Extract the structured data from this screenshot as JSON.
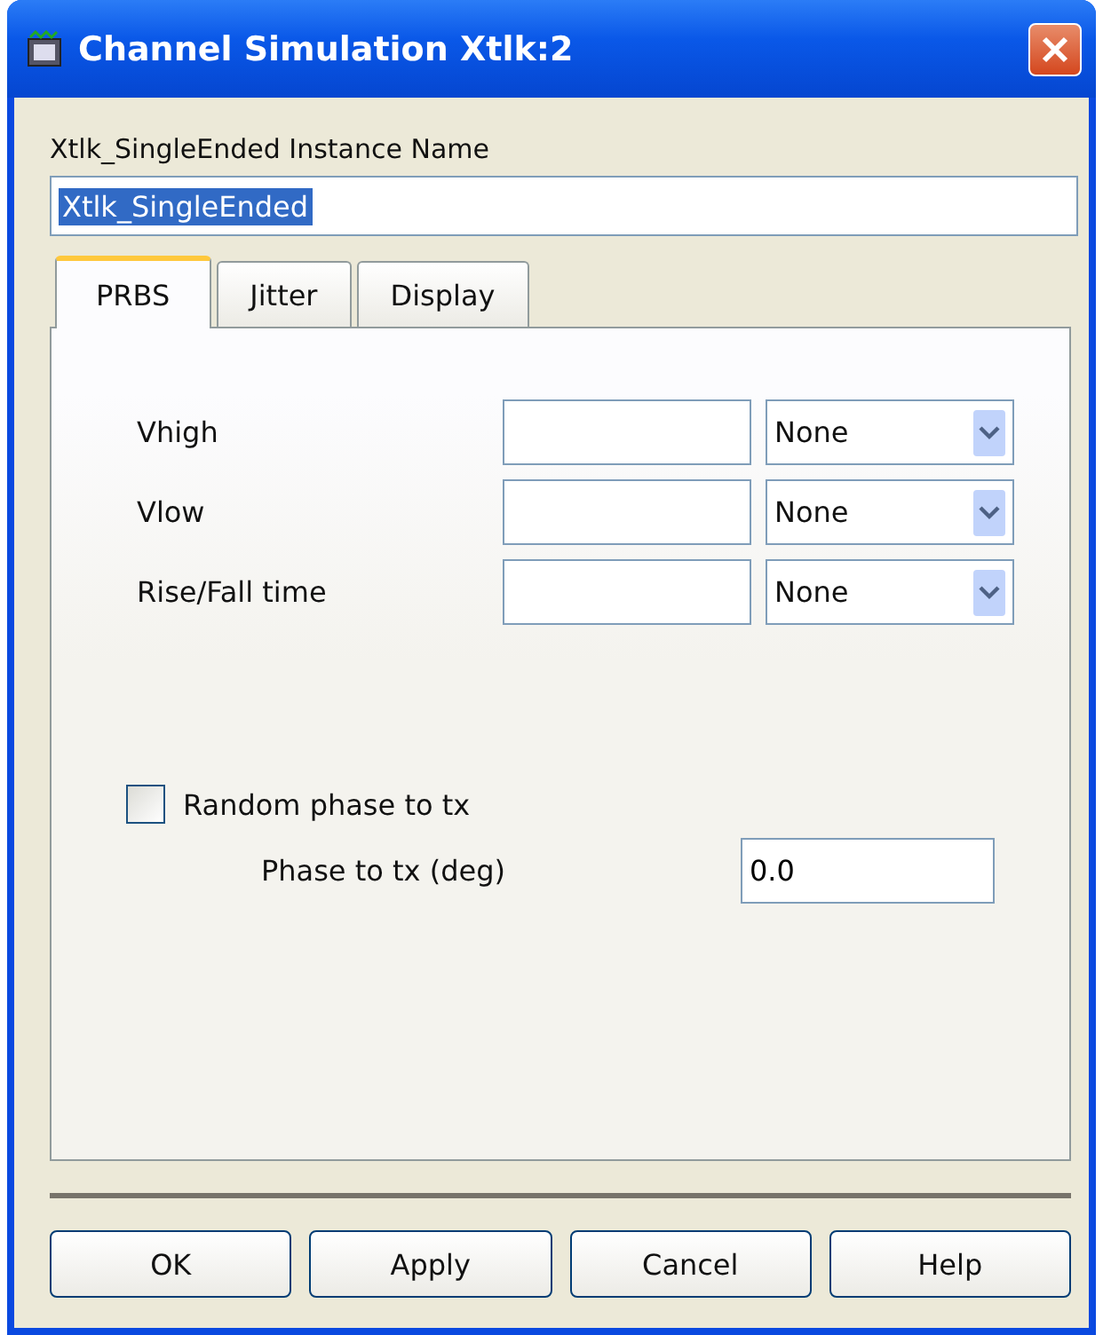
{
  "window": {
    "title": "Channel Simulation Xtlk:2"
  },
  "instance": {
    "label": "Xtlk_SingleEnded Instance Name",
    "value": "Xtlk_SingleEnded",
    "value_selected": true
  },
  "tabs": [
    {
      "label": "PRBS",
      "selected": true
    },
    {
      "label": "Jitter",
      "selected": false
    },
    {
      "label": "Display",
      "selected": false
    }
  ],
  "params": [
    {
      "label": "Vhigh",
      "unit": "None"
    },
    {
      "label": "Vlow",
      "unit": "None"
    },
    {
      "label": "Rise/Fall time",
      "unit": "None"
    }
  ],
  "random_phase": {
    "label": "Random phase to tx",
    "checked": false
  },
  "phase": {
    "label": "Phase to tx (deg)",
    "value": "0.0"
  },
  "buttons": [
    "OK",
    "Apply",
    "Cancel",
    "Help"
  ]
}
